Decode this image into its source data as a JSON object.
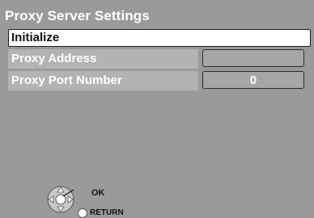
{
  "screen": {
    "title": "Proxy Server Settings",
    "initialize_label": "Initialize",
    "rows": [
      {
        "label": "Proxy Address",
        "value": ""
      },
      {
        "label": "Proxy Port Number",
        "value": "0"
      }
    ]
  },
  "remote_guide": {
    "ok_label": "OK",
    "return_label": "RETURN"
  },
  "colors": {
    "background": "#9a9a9a",
    "row_label_bg": "#b3b3b3",
    "field_bg": "#a6a6a6",
    "highlight": "#ffffff"
  },
  "icons": [
    "nav-pad-icon",
    "return-button-icon"
  ]
}
